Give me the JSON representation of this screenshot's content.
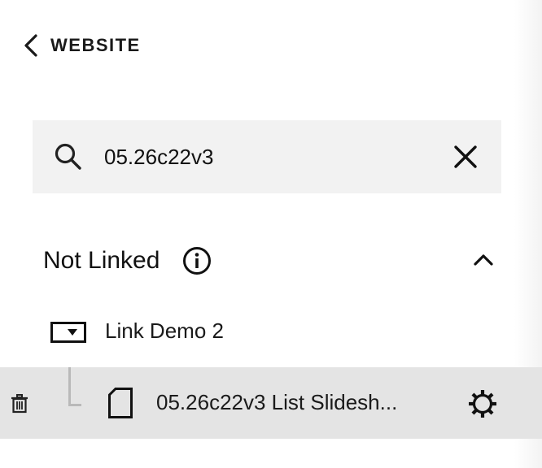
{
  "header": {
    "back_label": "WEBSITE",
    "back_icon": "chevron-left-icon"
  },
  "search": {
    "value": "05.26c22v3",
    "placeholder": "",
    "search_icon": "search-icon",
    "clear_icon": "close-icon"
  },
  "section": {
    "title": "Not Linked",
    "info_icon": "info-icon",
    "collapse_icon": "chevron-up-icon",
    "items": [
      {
        "label": "Link Demo 2",
        "icon": "folder-dropdown-icon"
      },
      {
        "label": "05.26c22v3 List Slidesh...",
        "icon": "page-icon",
        "actions": [
          "trash-icon",
          "gear-icon"
        ],
        "selected": true
      }
    ]
  },
  "colors": {
    "search_background": "#f2f2f2",
    "selected_row_background": "#e4e4e4",
    "text": "#111111",
    "connector": "#b9b9b9"
  }
}
